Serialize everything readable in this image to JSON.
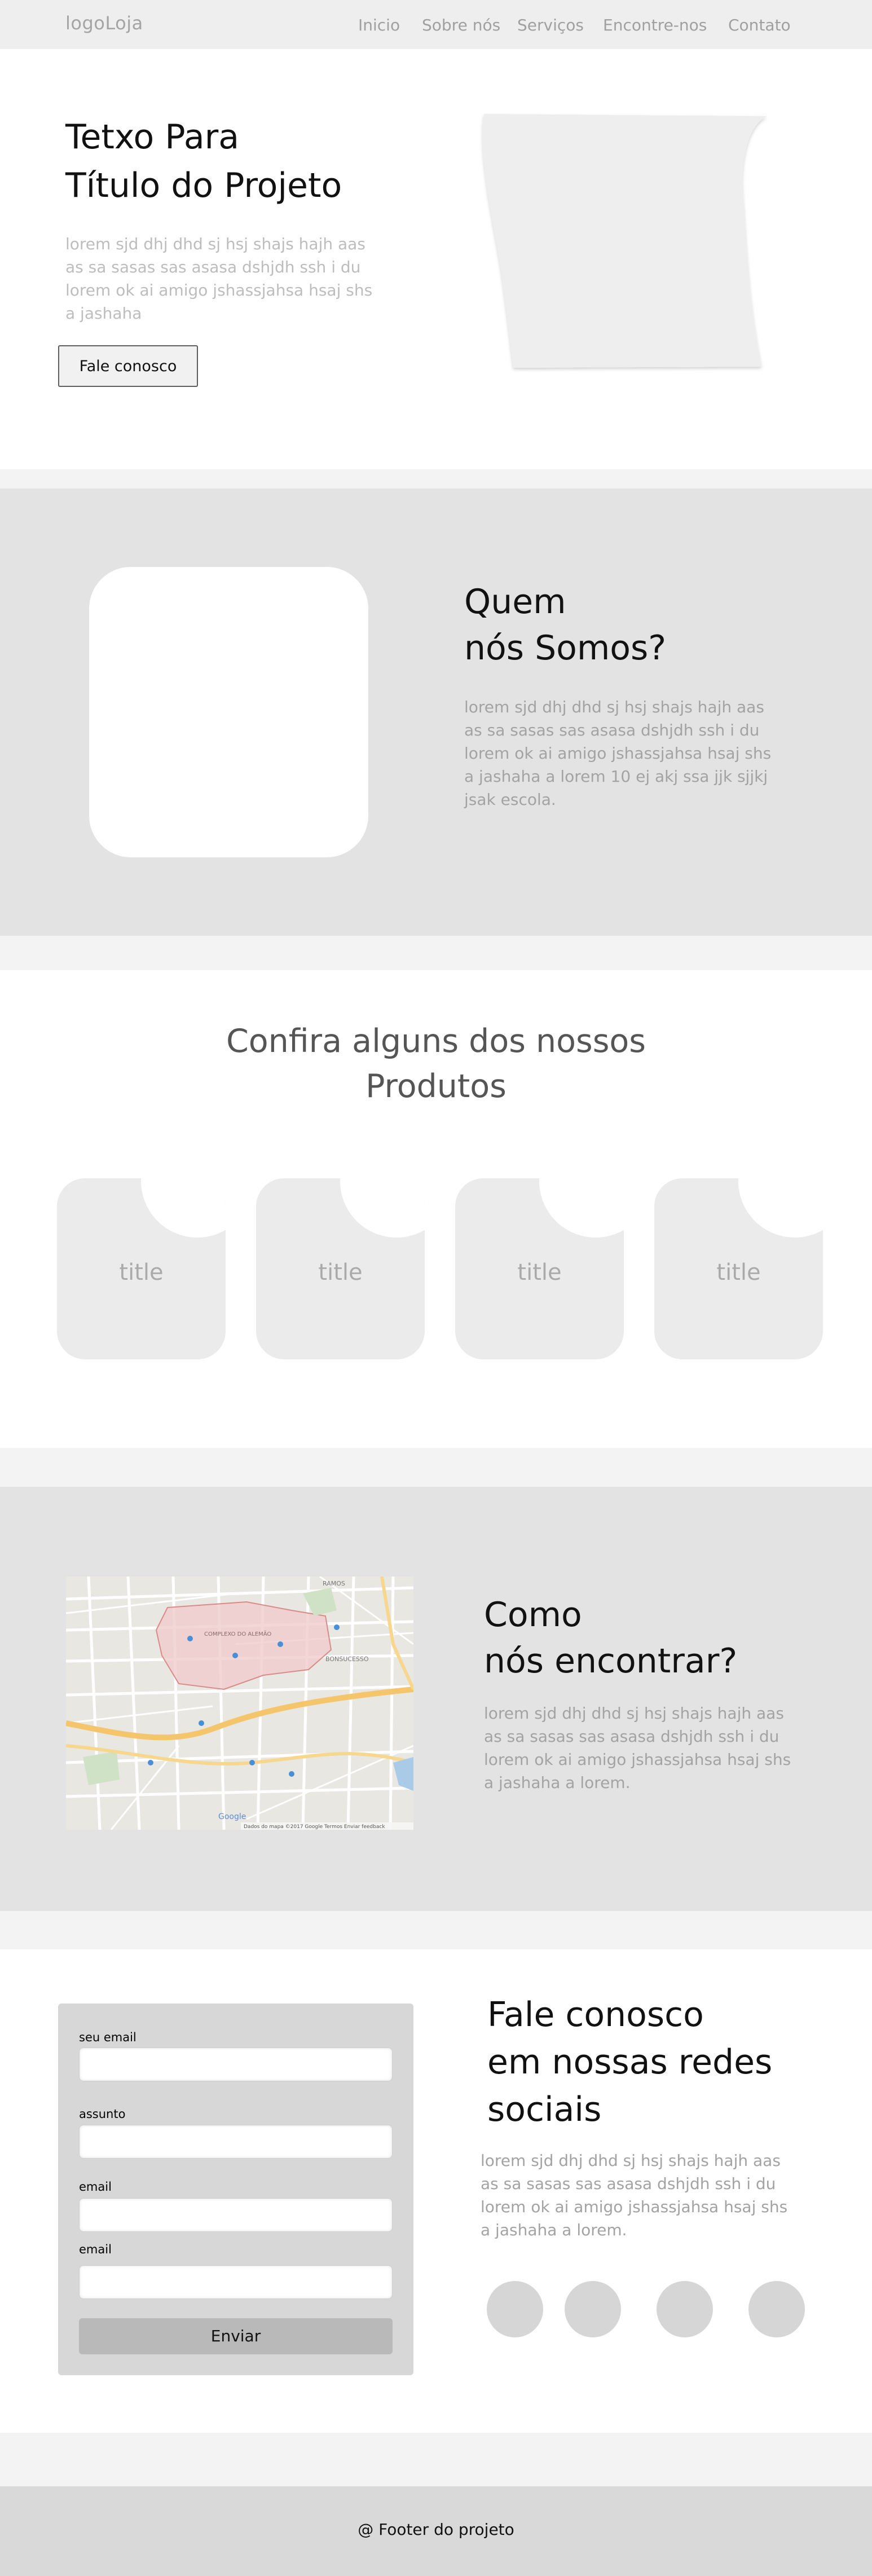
{
  "header": {
    "logo": "logoLoja",
    "nav": [
      "Inicio",
      "Sobre nós",
      "Serviços",
      "Encontre-nos",
      "Contato"
    ]
  },
  "hero": {
    "title_line1": "Tetxo Para",
    "title_line2": "Título do Projeto",
    "text": "lorem sjd dhj dhd sj hsj shajs  hajh  aas as  sa sasas sas asasa dshjdh ssh i du lorem ok ai amigo jshassjahsa hsaj shs a jashaha",
    "button": "Fale conosco"
  },
  "about": {
    "title_line1": "Quem",
    "title_line2": "nós Somos?",
    "text": "lorem sjd dhj dhd sj hsj shajs  hajh  aas as  sa sasas sas asasa dshjdh ssh i du lorem ok ai amigo jshassjahsa hsaj shs a jashaha a lorem 10 ej akj  ssa  jjk sjjkj jsak escola."
  },
  "products": {
    "title_line1": "Confira alguns dos nossos",
    "title_line2": "Produtos",
    "cards": [
      "title",
      "title",
      "title",
      "title"
    ]
  },
  "location": {
    "title_line1": "Como",
    "title_line2": "nós encontrar?",
    "text": "lorem sjd dhj dhd sj hsj shajs  hajh  aas as  sa sasas sas asasa dshjdh ssh i du lorem ok ai amigo jshassjahsa hsaj shs a jashaha a lorem.",
    "map_labels": {
      "ramos": "RAMOS",
      "complexo": "COMPLEXO DO ALEMÃO",
      "bonsucesso": "BONSUCESSO",
      "google": "Google",
      "attribution": "Dados do mapa ©2017 Google   Termos   Enviar feedback"
    }
  },
  "contact": {
    "title_line1": "Fale conosco",
    "title_line2": "em nossas redes",
    "title_line3": "sociais",
    "text": "lorem sjd dhj dhd sj hsj shajs  hajh  aas as  sa sasas sas asasa dshjdh ssh i du lorem ok ai amigo jshassjahsa hsaj shs a jashaha a lorem.",
    "form": {
      "label_email": "seu email",
      "label_subject": "assunto",
      "label_email2": "email",
      "label_email3": "email",
      "submit": "Enviar"
    }
  },
  "footer": {
    "text": "@ Footer do projeto"
  },
  "colors": {
    "header_bg": "#eeeeee",
    "section_gray": "#e3e3e3",
    "muted_text": "#a3a3a3",
    "footer_bg": "#d9d9d9"
  }
}
